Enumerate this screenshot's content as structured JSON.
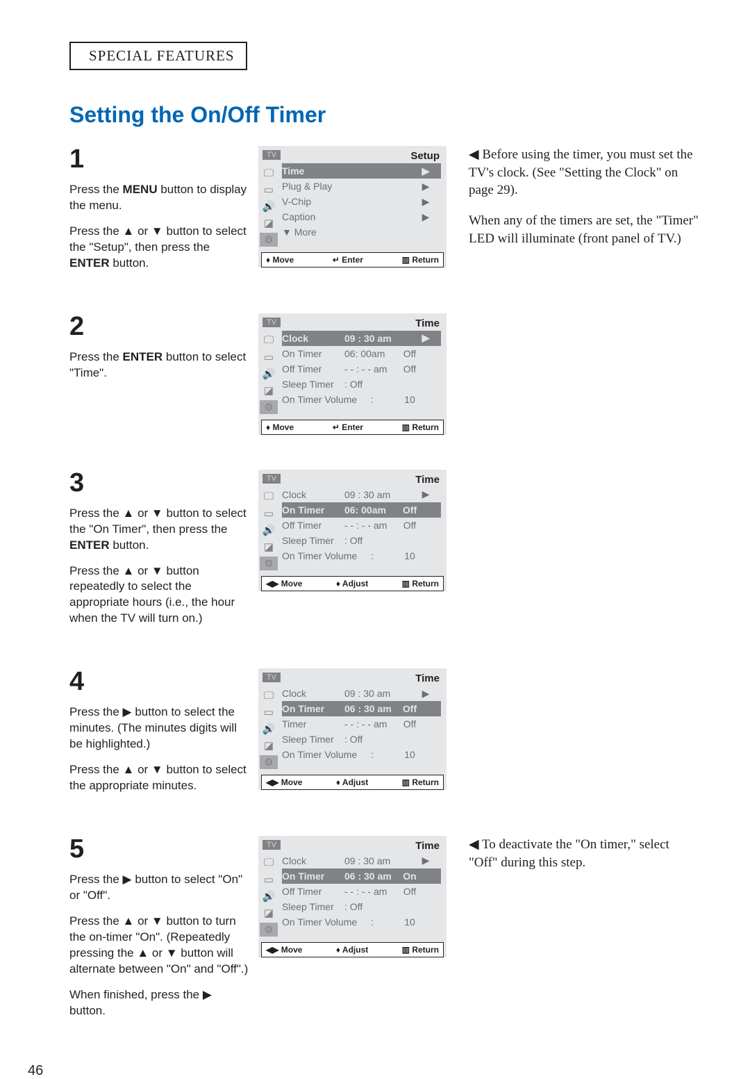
{
  "chapter": "SPECIAL FEATURES",
  "title": "Setting the On/Off Timer",
  "page_number": "46",
  "note1": "◀  Before using the timer, you must set the TV's clock. (See \"Setting the Clock\" on page 29).",
  "note2": "When any of the timers are set, the \"Timer\" LED will illuminate (front panel of TV.)",
  "note5": "◀  To deactivate the \"On timer,\" select \"Off\" during this step.",
  "steps": {
    "s1": {
      "num": "1",
      "t1": "Press the ",
      "menu": "MENU",
      "t2": " button to display the menu.",
      "t3": "Press the ▲ or ▼ button to select the \"Setup\", then press the ",
      "enter": "ENTER",
      "t4": " button."
    },
    "s2": {
      "num": "2",
      "t1": "Press the ",
      "enter": "ENTER",
      "t2": " button to select \"Time\"."
    },
    "s3": {
      "num": "3",
      "t1": "Press the ▲ or ▼ button to select the \"On Timer\", then press the ",
      "enter": "ENTER",
      "t2": " button.",
      "t3": "Press the ▲ or ▼ button repeatedly to select the appropriate hours (i.e., the hour when the TV will turn on.)"
    },
    "s4": {
      "num": "4",
      "t1": "Press the ▶ button to select the minutes. (The minutes digits will be highlighted.)",
      "t2": "Press the ▲ or ▼ button to select the appropriate minutes."
    },
    "s5": {
      "num": "5",
      "t1": "Press the ▶ button to select  \"On\" or \"Off\".",
      "t2": "Press the ▲ or ▼ button to turn the on-timer \"On\". (Repeatedly pressing the ▲ or ▼ button will alternate between \"On\" and \"Off\".)",
      "t3": "When finished, press the ▶ button."
    }
  },
  "osd_common": {
    "tv": "TV",
    "move_ud": "♦ Move",
    "move_lr": "◀▶ Move",
    "enter": "↵ Enter",
    "adjust": "♦ Adjust",
    "return": "▥ Return"
  },
  "osd1": {
    "title": "Setup",
    "items": [
      {
        "lbl": "Time",
        "sel": true,
        "arr": "▶"
      },
      {
        "lbl": "Plug & Play",
        "arr": "▶"
      },
      {
        "lbl": "V-Chip",
        "arr": "▶"
      },
      {
        "lbl": "Caption",
        "arr": "▶"
      },
      {
        "lbl": "▼ More"
      }
    ]
  },
  "osd2": {
    "title": "Time",
    "items": [
      {
        "lbl": "Clock",
        "val": "09 : 30 am",
        "sel": true,
        "arr": "▶"
      },
      {
        "lbl": "On Timer",
        "val": "06: 00am",
        "st": "Off"
      },
      {
        "lbl": "Off Timer",
        "val": "- - : - - am",
        "st": "Off"
      },
      {
        "lbl": "Sleep Timer",
        "val": ": Off"
      },
      {
        "lbl": "On Timer Volume",
        "val": ":",
        "st": "10"
      }
    ]
  },
  "osd3": {
    "title": "Time",
    "items": [
      {
        "lbl": "Clock",
        "val": "09 : 30 am",
        "arr": "▶"
      },
      {
        "lbl": "On Timer",
        "val": "06: 00am",
        "st": "Off",
        "sel": true
      },
      {
        "lbl": "Off Timer",
        "val": "- - : - - am",
        "st": "Off"
      },
      {
        "lbl": "Sleep Timer",
        "val": ": Off"
      },
      {
        "lbl": "On Timer Volume",
        "val": ":",
        "st": "10"
      }
    ]
  },
  "osd4": {
    "title": "Time",
    "items": [
      {
        "lbl": "Clock",
        "val": "09 : 30 am",
        "arr": "▶"
      },
      {
        "lbl": "On Timer",
        "val": "06 : 30 am",
        "st": "Off",
        "sel": true
      },
      {
        "lbl": "Timer",
        "val": "- - : - - am",
        "st": "Off"
      },
      {
        "lbl": "Sleep Timer",
        "val": ": Off"
      },
      {
        "lbl": "On Timer Volume",
        "val": ":",
        "st": "10"
      }
    ]
  },
  "osd5": {
    "title": "Time",
    "items": [
      {
        "lbl": "Clock",
        "val": "09 : 30 am",
        "arr": "▶"
      },
      {
        "lbl": "On Timer",
        "val": "06 : 30 am",
        "st": "On",
        "sel": true
      },
      {
        "lbl": "Off Timer",
        "val": "- - : - - am",
        "st": "Off"
      },
      {
        "lbl": "Sleep Timer",
        "val": ": Off"
      },
      {
        "lbl": "On Timer Volume",
        "val": ":",
        "st": "10"
      }
    ]
  }
}
